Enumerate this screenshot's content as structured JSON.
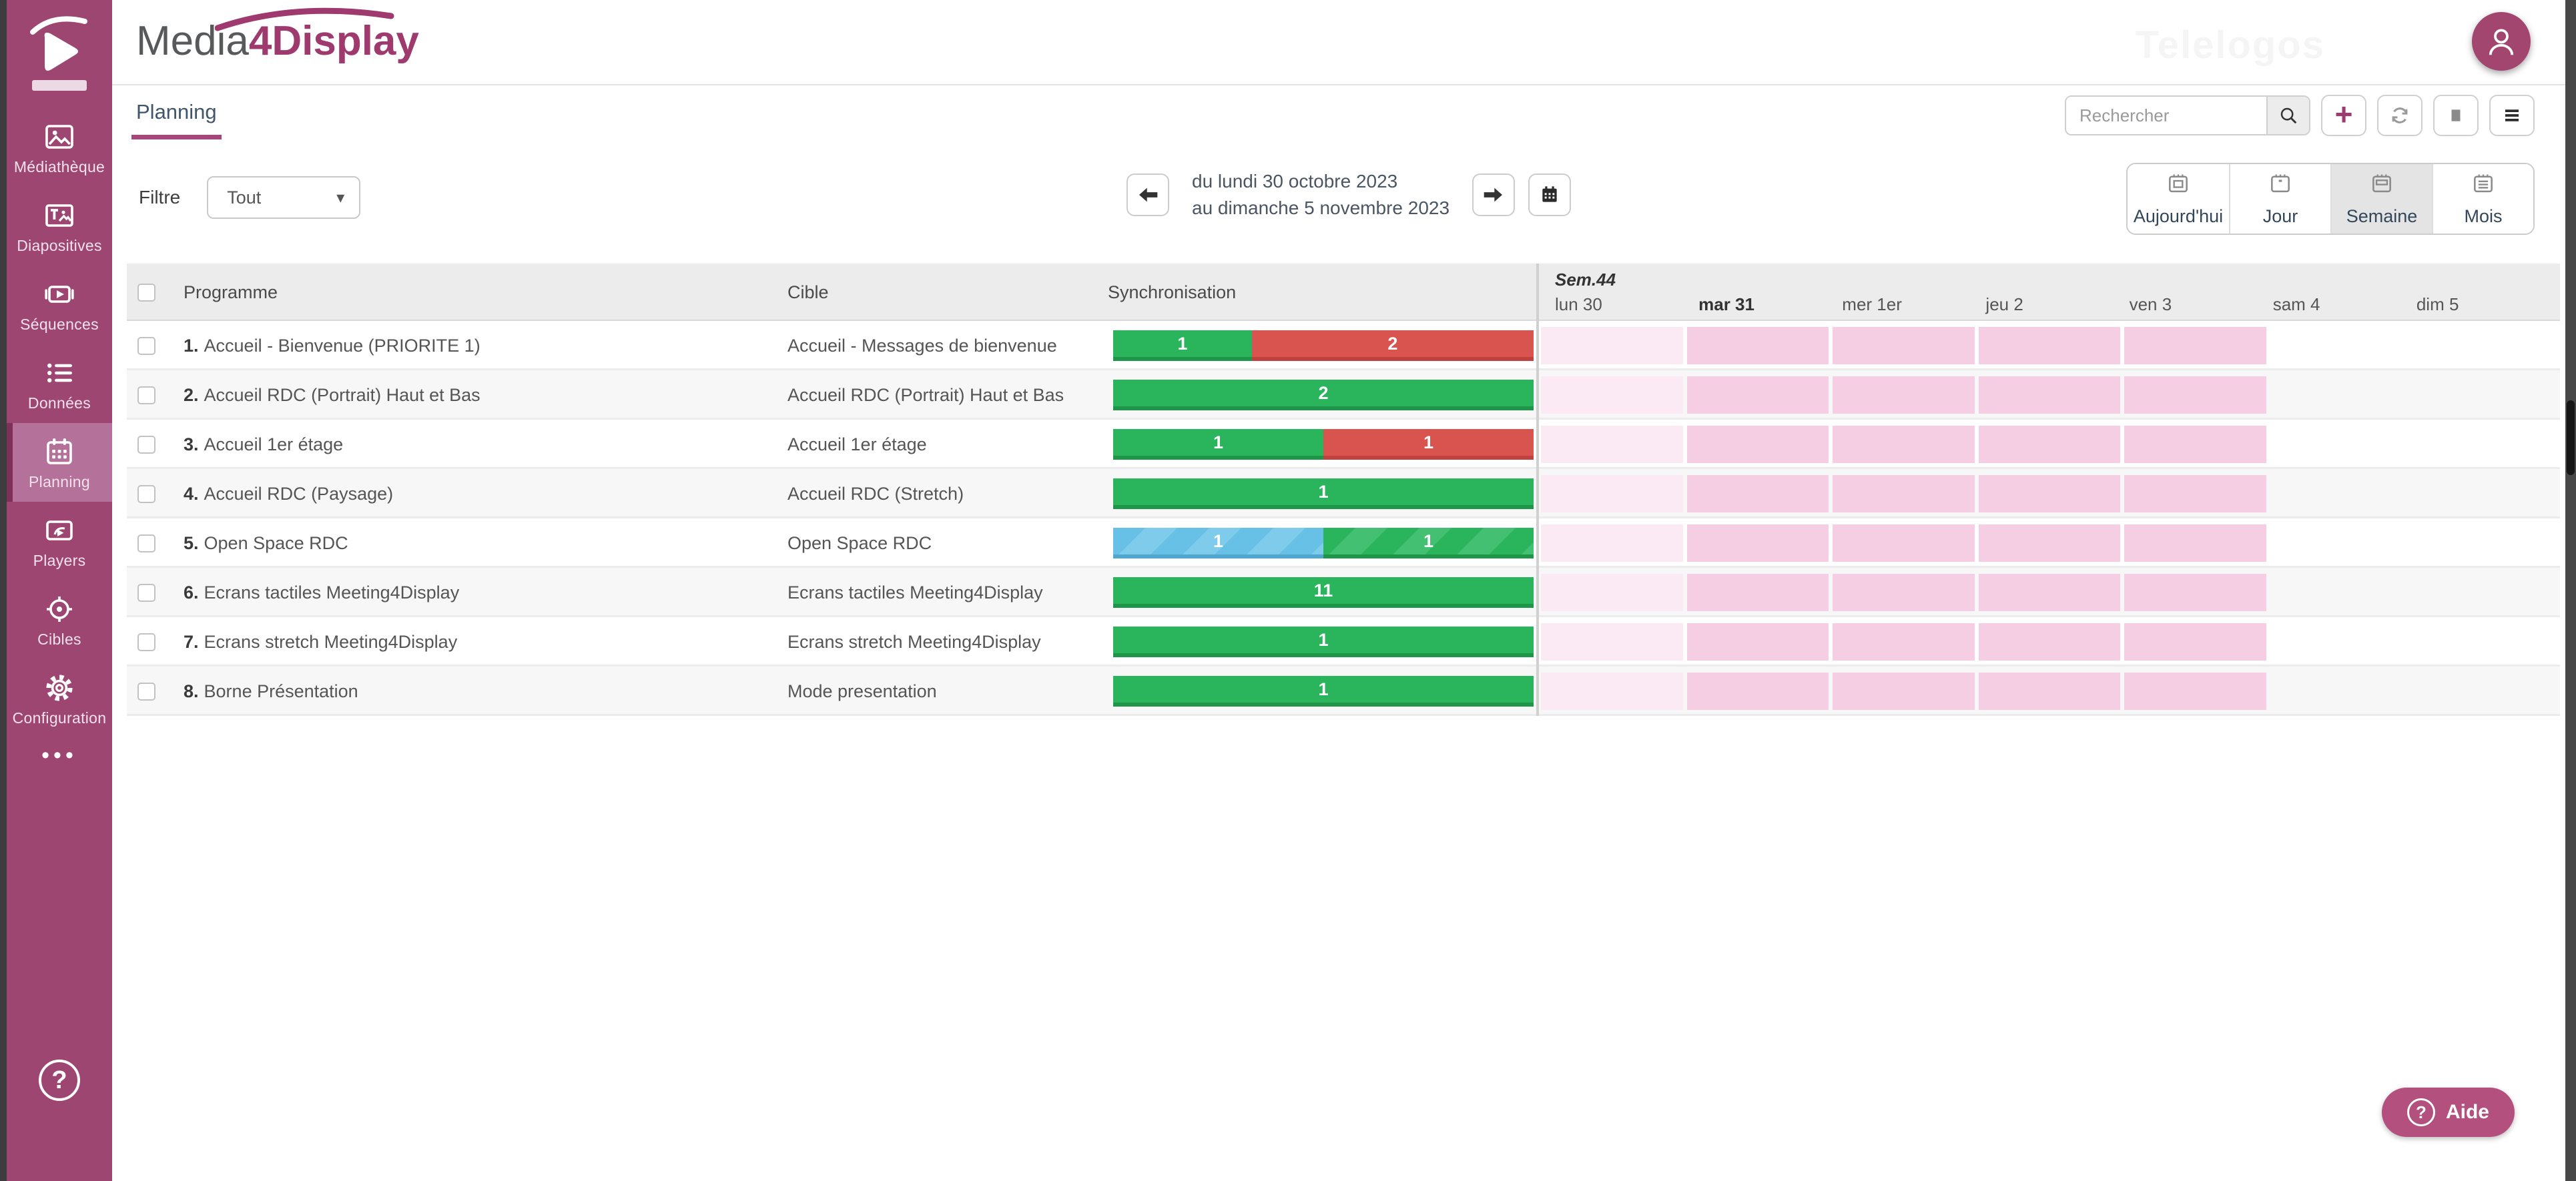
{
  "app": {
    "brand_part1": "Media",
    "brand_part2": "4Display",
    "watermark": "Telelogos"
  },
  "colors": {
    "accent": "#9e3a6d",
    "sidebar": "#9e4672",
    "sidebar_active": "#b4719a",
    "green": "#2ab45c",
    "red": "#d9534f",
    "blue": "#67c0e6",
    "pink_day": "#f5cee4",
    "pink_day_light": "#fbeaf4"
  },
  "sidebar": {
    "items": [
      {
        "id": "mediatheque",
        "label": "Médiathèque",
        "icon": "media-library",
        "active": false
      },
      {
        "id": "diapositives",
        "label": "Diapositives",
        "icon": "slides",
        "active": false
      },
      {
        "id": "sequences",
        "label": "Séquences",
        "icon": "sequences",
        "active": false
      },
      {
        "id": "donnees",
        "label": "Données",
        "icon": "data-list",
        "active": false
      },
      {
        "id": "planning",
        "label": "Planning",
        "icon": "calendar",
        "active": true
      },
      {
        "id": "players",
        "label": "Players",
        "icon": "players",
        "active": false
      },
      {
        "id": "cibles",
        "label": "Cibles",
        "icon": "targets",
        "active": false
      },
      {
        "id": "configuration",
        "label": "Configuration",
        "icon": "settings",
        "active": false
      }
    ],
    "more_label": "•••",
    "help_label": "?"
  },
  "tab": {
    "label": "Planning"
  },
  "search": {
    "placeholder": "Rechercher"
  },
  "filter": {
    "label": "Filtre",
    "value": "Tout"
  },
  "date_nav": {
    "line1": "du lundi 30 octobre 2023",
    "line2": "au dimanche 5 novembre 2023"
  },
  "views": {
    "buttons": [
      {
        "id": "today",
        "label": "Aujourd'hui",
        "active": false
      },
      {
        "id": "day",
        "label": "Jour",
        "active": false
      },
      {
        "id": "week",
        "label": "Semaine",
        "active": true
      },
      {
        "id": "month",
        "label": "Mois",
        "active": false
      }
    ]
  },
  "table": {
    "columns": {
      "programme": "Programme",
      "cible": "Cible",
      "sync": "Synchronisation"
    },
    "week_label": "Sem.44",
    "days": [
      {
        "label": "lun 30",
        "today": false
      },
      {
        "label": "mar 31",
        "today": true
      },
      {
        "label": "mer 1er",
        "today": false
      },
      {
        "label": "jeu 2",
        "today": false
      },
      {
        "label": "ven 3",
        "today": false
      },
      {
        "label": "sam 4",
        "today": false
      },
      {
        "label": "dim 5",
        "today": false
      }
    ],
    "rows": [
      {
        "num": "1.",
        "programme": "Accueil - Bienvenue (PRIORITE 1)",
        "cible": "Accueil - Messages de bienvenue",
        "segments": [
          {
            "style": "green",
            "value": "1",
            "pct": 33
          },
          {
            "style": "red",
            "value": "2",
            "pct": 67
          }
        ],
        "schedule": [
          "past",
          "on",
          "on",
          "on",
          "on",
          "off",
          "off"
        ]
      },
      {
        "num": "2.",
        "programme": "Accueil RDC (Portrait) Haut et Bas",
        "cible": "Accueil RDC (Portrait) Haut et Bas",
        "segments": [
          {
            "style": "green",
            "value": "2",
            "pct": 100
          }
        ],
        "schedule": [
          "past",
          "on",
          "on",
          "on",
          "on",
          "off",
          "off"
        ]
      },
      {
        "num": "3.",
        "programme": "Accueil 1er étage",
        "cible": "Accueil 1er étage",
        "segments": [
          {
            "style": "green",
            "value": "1",
            "pct": 50
          },
          {
            "style": "red",
            "value": "1",
            "pct": 50
          }
        ],
        "schedule": [
          "past",
          "on",
          "on",
          "on",
          "on",
          "off",
          "off"
        ]
      },
      {
        "num": "4.",
        "programme": "Accueil RDC (Paysage)",
        "cible": "Accueil RDC (Stretch)",
        "segments": [
          {
            "style": "green",
            "value": "1",
            "pct": 100
          }
        ],
        "schedule": [
          "past",
          "on",
          "on",
          "on",
          "on",
          "off",
          "off"
        ]
      },
      {
        "num": "5.",
        "programme": "Open Space RDC",
        "cible": "Open Space RDC",
        "segments": [
          {
            "style": "blue-striped",
            "value": "1",
            "pct": 50
          },
          {
            "style": "green-striped",
            "value": "1",
            "pct": 50
          }
        ],
        "schedule": [
          "past",
          "on",
          "on",
          "on",
          "on",
          "off",
          "off"
        ]
      },
      {
        "num": "6.",
        "programme": "Ecrans tactiles Meeting4Display",
        "cible": "Ecrans tactiles Meeting4Display",
        "segments": [
          {
            "style": "green",
            "value": "11",
            "pct": 100
          }
        ],
        "schedule": [
          "past",
          "on",
          "on",
          "on",
          "on",
          "off",
          "off"
        ]
      },
      {
        "num": "7.",
        "programme": "Ecrans stretch Meeting4Display",
        "cible": "Ecrans stretch Meeting4Display",
        "segments": [
          {
            "style": "green",
            "value": "1",
            "pct": 100
          }
        ],
        "schedule": [
          "past",
          "on",
          "on",
          "on",
          "on",
          "off",
          "off"
        ]
      },
      {
        "num": "8.",
        "programme": "Borne Présentation",
        "cible": "Mode presentation",
        "segments": [
          {
            "style": "green",
            "value": "1",
            "pct": 100
          }
        ],
        "schedule": [
          "past",
          "on",
          "on",
          "on",
          "on",
          "off",
          "off"
        ]
      }
    ]
  },
  "help": {
    "label": "Aide"
  }
}
